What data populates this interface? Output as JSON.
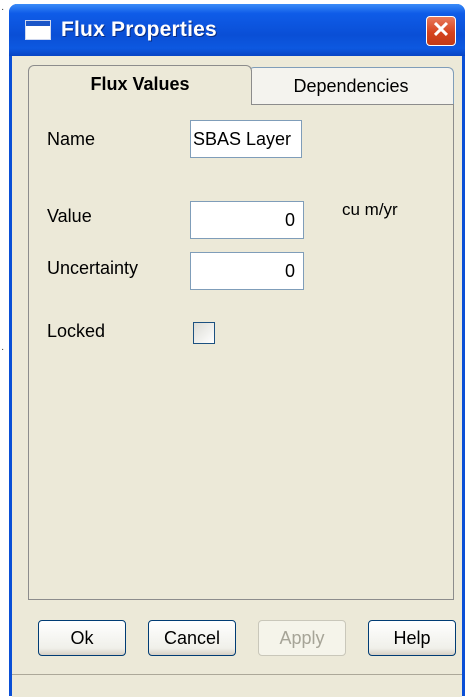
{
  "window": {
    "title": "Flux Properties",
    "close_glyph": "✕"
  },
  "tabs": [
    {
      "label": "Flux Values",
      "active": true
    },
    {
      "label": "Dependencies",
      "active": false
    }
  ],
  "form": {
    "name_label": "Name",
    "name_value": "SBAS Layer",
    "value_label": "Value",
    "value_value": "0",
    "value_unit": "cu m/yr",
    "uncertainty_label": "Uncertainty",
    "uncertainty_value": "0",
    "locked_label": "Locked",
    "locked_checked": false
  },
  "buttons": {
    "ok": "Ok",
    "cancel": "Cancel",
    "apply": "Apply",
    "help": "Help"
  },
  "colors": {
    "title_blue": "#0a4fd6",
    "close_red": "#d6431e",
    "dialog_face": "#ece9d8"
  }
}
